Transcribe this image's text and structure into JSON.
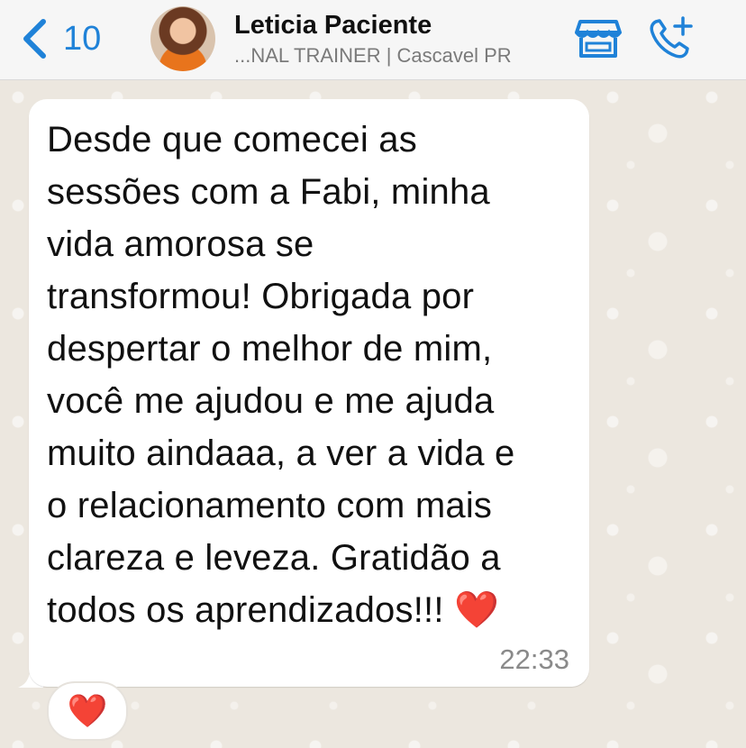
{
  "header": {
    "back_count": "10",
    "contact_name": "Leticia Paciente",
    "contact_subtitle": "...NAL TRAINER | Cascavel PR"
  },
  "icons": {
    "back": "chevron-left-icon",
    "store": "store-icon",
    "call": "add-call-icon"
  },
  "colors": {
    "accent": "#1f82d8",
    "bubble": "#ffffff",
    "wallpaper": "#ece7df"
  },
  "message": {
    "text": "Desde que comecei as\nsessões com a Fabi, minha\nvida amorosa se\ntransformou! Obrigada por\ndespertar o melhor de mim,\nvocê me ajudou e me ajuda\nmuito aindaaa, a ver a vida e\no relacionamento com mais\nclareza e leveza. Gratidão a\ntodos os aprendizados!!! ❤️",
    "time": "22:33",
    "reaction": "❤️"
  }
}
